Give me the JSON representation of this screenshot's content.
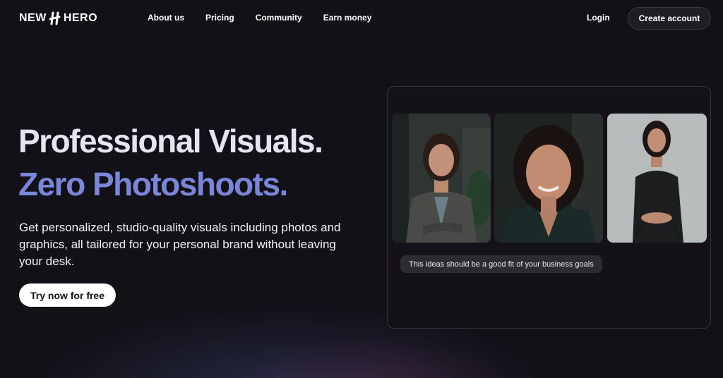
{
  "brand": {
    "name_left": "NEW",
    "name_right": "HERO"
  },
  "nav": {
    "links": [
      "About us",
      "Pricing",
      "Community",
      "Earn money"
    ],
    "login": "Login",
    "create_account": "Create account"
  },
  "hero": {
    "headline_1": "Professional Visuals.",
    "headline_2": "Zero Photoshoots.",
    "subtitle": "Get personalized, studio-quality visuals including photos and graphics, all tailored for your personal brand without leaving your desk.",
    "cta": "Try now for free"
  },
  "showcase": {
    "caption": "This ideas should be a good fit of your business goals"
  },
  "colors": {
    "accent": "#7b86d8",
    "background": "#131118"
  }
}
